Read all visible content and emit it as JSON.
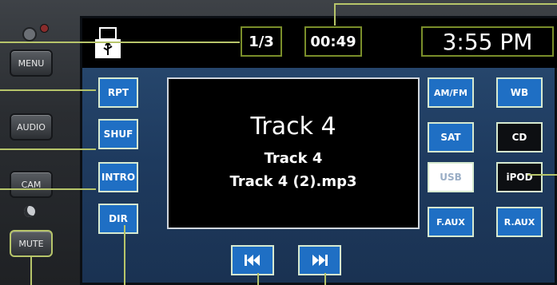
{
  "status_bar": {
    "track_count": "1/3",
    "elapsed_time": "00:49",
    "clock": "3:55 PM",
    "usb_icon": "usb-device-icon"
  },
  "hardware_buttons": {
    "menu": "MENU",
    "audio": "AUDIO",
    "cam": "CAM",
    "mute": "MUTE"
  },
  "playback_buttons": {
    "repeat": "RPT",
    "shuffle": "SHUF",
    "intro": "INTRO",
    "directory": "DIR"
  },
  "now_playing": {
    "title": "Track 4",
    "subtitle": "Track 4",
    "filename": "Track 4 (2).mp3"
  },
  "sources": {
    "am_fm": "AM/FM",
    "wb": "WB",
    "sat": "SAT",
    "cd": "CD",
    "usb": "USB",
    "ipod": "iPOD",
    "front_aux": "F.AUX",
    "rear_aux": "R.AUX"
  },
  "transport": {
    "previous_icon": "skip-previous-icon",
    "next_icon": "skip-next-icon"
  },
  "colors": {
    "screen_blue": "#1f6fc4",
    "callout_line": "#b7c56a",
    "status_border": "#7a8e2a"
  }
}
